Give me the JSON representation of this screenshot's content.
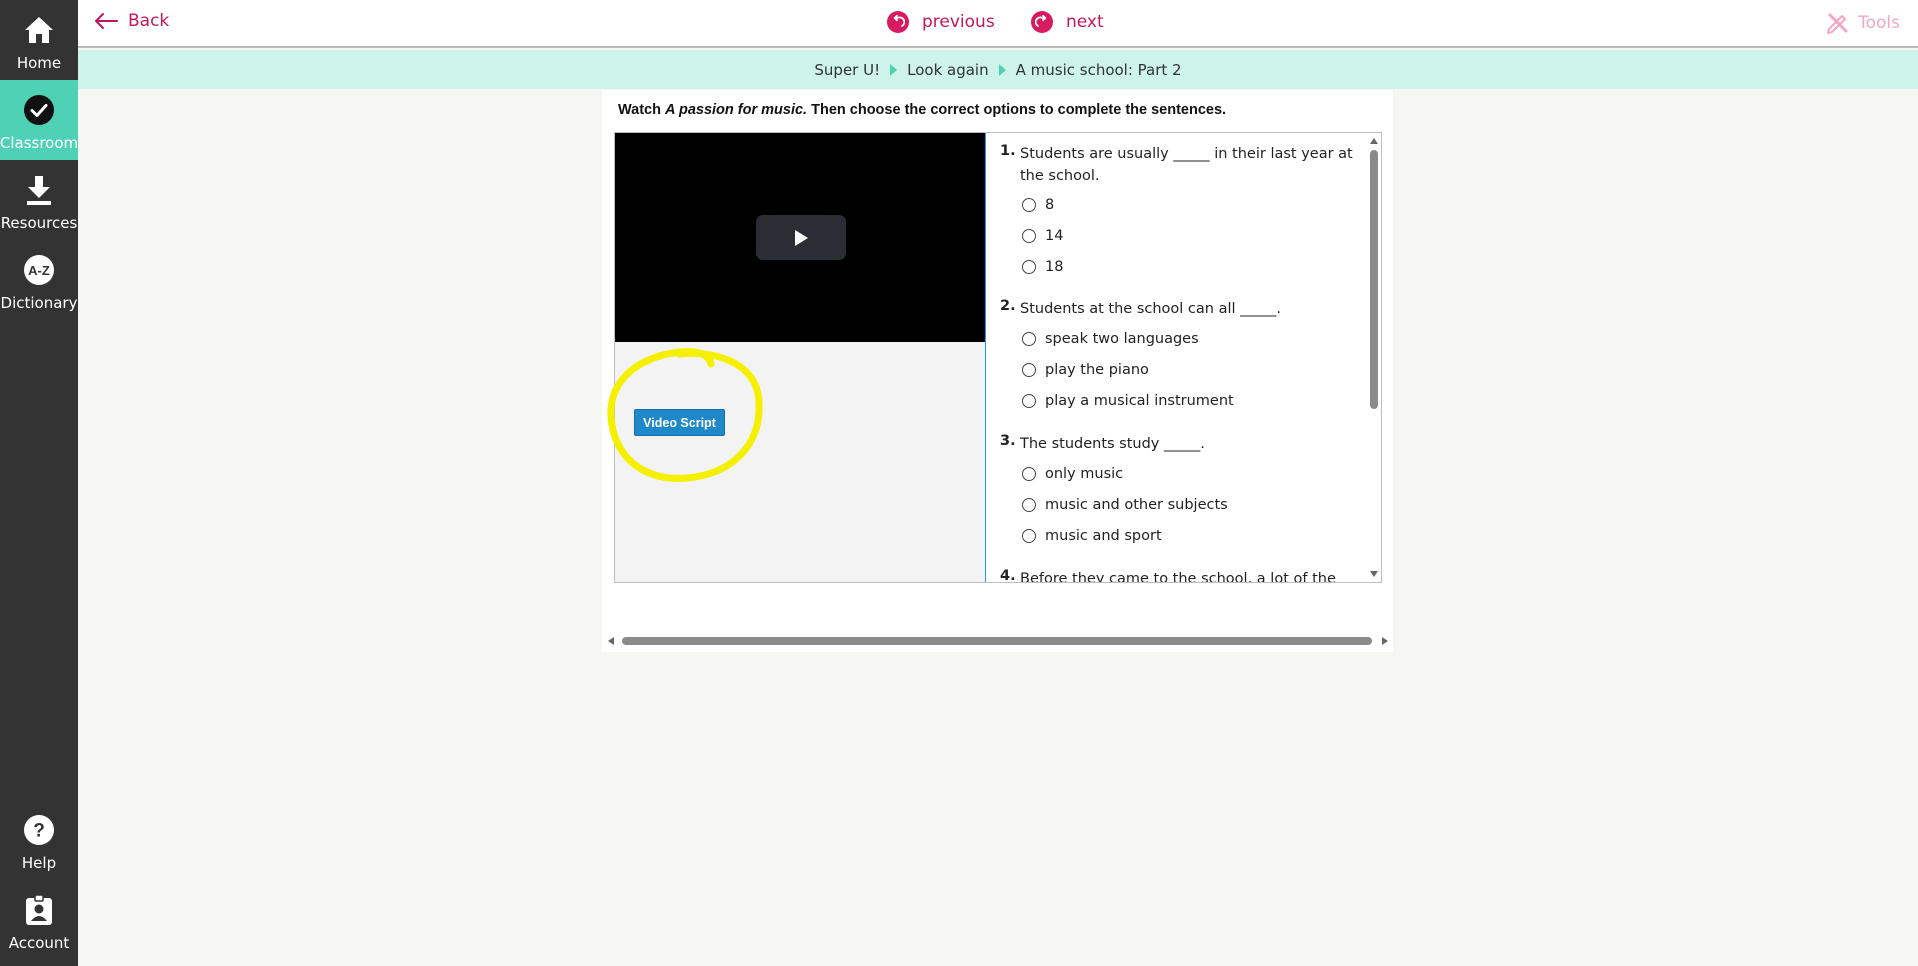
{
  "sidebar": {
    "items": [
      {
        "label": "Home",
        "icon": "home-icon"
      },
      {
        "label": "Classroom",
        "icon": "check-circle-icon",
        "active": true
      },
      {
        "label": "Resources",
        "icon": "download-icon"
      },
      {
        "label": "Dictionary",
        "icon": "az-dictionary-icon"
      },
      {
        "label": "Help",
        "icon": "help-icon"
      },
      {
        "label": "Account",
        "icon": "account-icon"
      }
    ]
  },
  "topbar": {
    "back_label": "Back",
    "previous_label": "previous",
    "next_label": "next",
    "tools_label": "Tools"
  },
  "breadcrumb": [
    "Super U!",
    "Look again",
    "A music school: Part 2"
  ],
  "instruction": {
    "prefix": "Watch ",
    "title": "A passion for music.",
    "suffix": " Then choose the correct options to complete the sentences."
  },
  "video_script_label": "Video Script",
  "questions": [
    {
      "num": "1.",
      "text": "Students are usually _____ in their last year at the school.",
      "options": [
        "8",
        "14",
        "18"
      ]
    },
    {
      "num": "2.",
      "text": "Students at the school can all _____.",
      "options": [
        "speak two languages",
        "play the piano",
        "play a musical instrument"
      ]
    },
    {
      "num": "3.",
      "text": "The students study _____.",
      "options": [
        "only music",
        "music and other subjects",
        "music and sport"
      ]
    },
    {
      "num": "4.",
      "text": "Before they came to the school, a lot of the",
      "options": []
    }
  ],
  "colors": {
    "sidebar": "#333333",
    "active": "#4fd1b6",
    "accent": "#c2185b",
    "breadcrumb_bg": "#cdf3ea",
    "button": "#1e88c9",
    "highlight": "#f5f000"
  }
}
